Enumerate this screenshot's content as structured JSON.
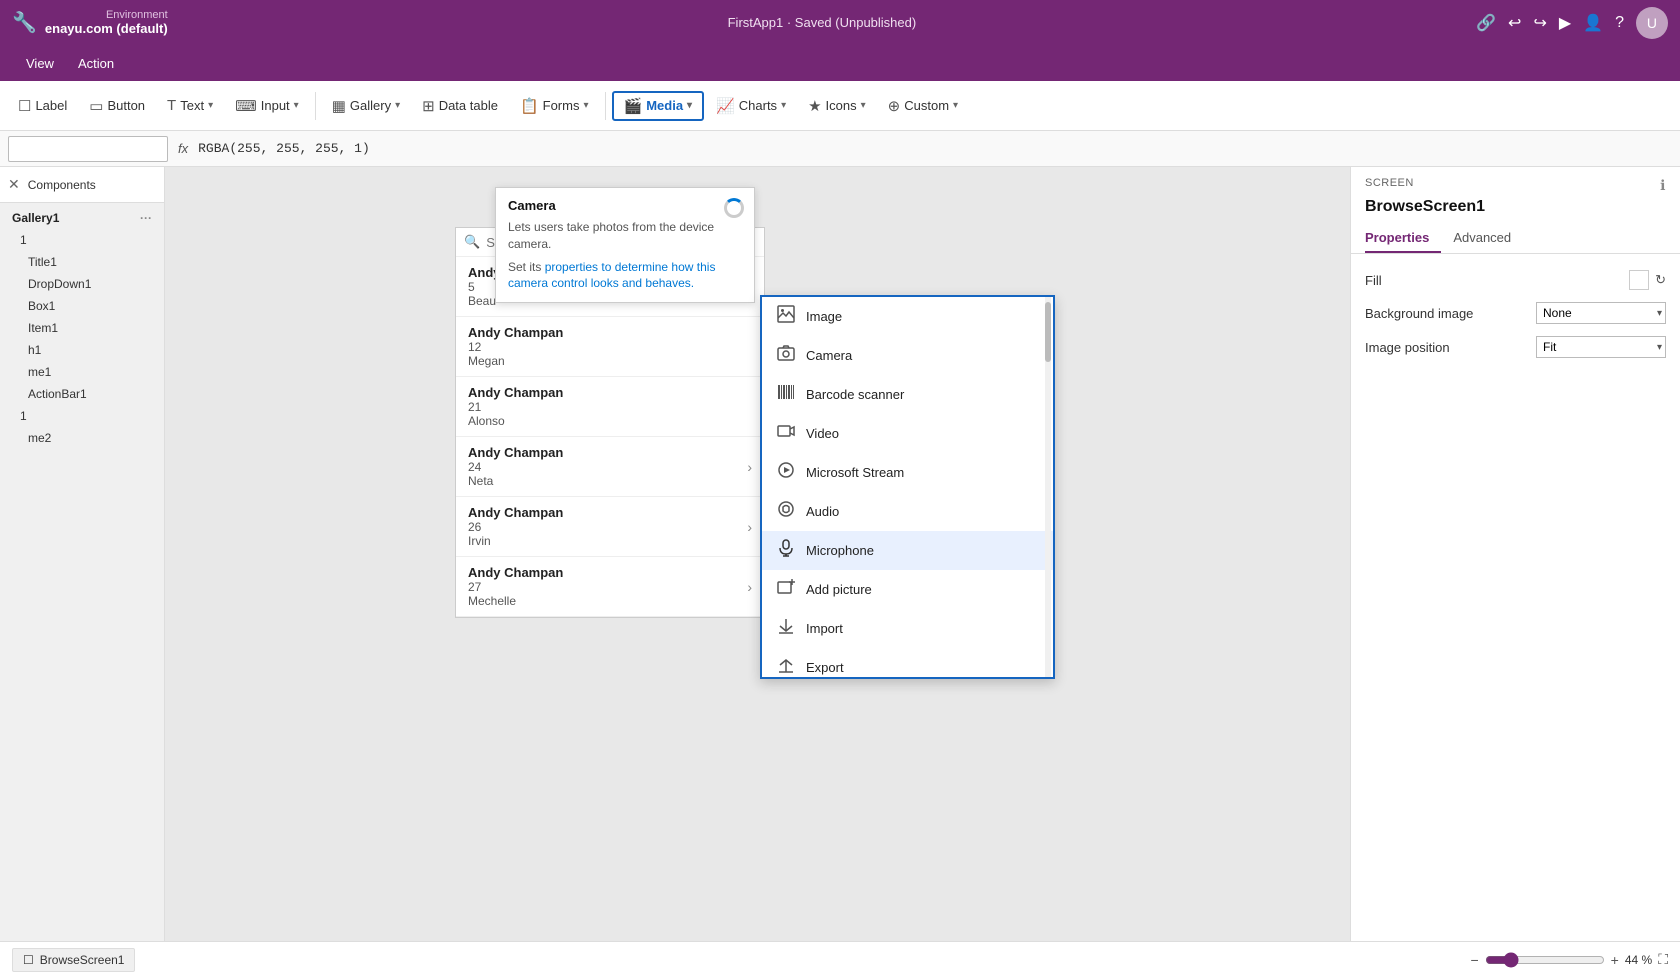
{
  "titleBar": {
    "env_label": "Environment",
    "env_name": "enayu.com (default)",
    "avatar_initials": "U"
  },
  "menuBar": {
    "items": [
      "View",
      "Action"
    ],
    "app_title": "FirstApp1 · Saved (Unpublished)"
  },
  "toolbar": {
    "label_btn": "Label",
    "button_btn": "Button",
    "text_btn": "Text",
    "input_btn": "Input",
    "gallery_btn": "Gallery",
    "datatable_btn": "Data table",
    "forms_btn": "Forms",
    "media_btn": "Media",
    "charts_btn": "Charts",
    "icons_btn": "Icons",
    "custom_btn": "Custom"
  },
  "formulaBar": {
    "selector_value": "",
    "formula_label": "fx",
    "formula_value": "RGBA(255, 255, 255, 1)"
  },
  "leftPanel": {
    "title": "Components",
    "treeItems": [
      {
        "id": "gallery1",
        "label": "Gallery1",
        "indent": 0
      },
      {
        "id": "item1",
        "label": "1",
        "indent": 1
      },
      {
        "id": "title1",
        "label": "Title1",
        "indent": 2
      },
      {
        "id": "dropdown1",
        "label": "DropDown1",
        "indent": 2
      },
      {
        "id": "box1",
        "label": "Box1",
        "indent": 2
      },
      {
        "id": "item1b",
        "label": "Item1",
        "indent": 2
      },
      {
        "id": "h1",
        "label": "h1",
        "indent": 2
      },
      {
        "id": "me1",
        "label": "me1",
        "indent": 2
      },
      {
        "id": "actionbar1",
        "label": "ActionBar1",
        "indent": 2
      },
      {
        "id": "item2",
        "label": "1",
        "indent": 1
      },
      {
        "id": "me2",
        "label": "me2",
        "indent": 2
      }
    ]
  },
  "cameraTooltip": {
    "title": "Camera",
    "description": "Lets users take photos from the device camera.",
    "linkText1": "properties to determine how this",
    "linkText2": "camera control looks and behaves.",
    "prefix": "Set its "
  },
  "searchBar": {
    "placeholder": "Search items"
  },
  "listItems": [
    {
      "name": "Andy Champan",
      "num": "5",
      "sub": "Beau"
    },
    {
      "name": "Andy Champan",
      "num": "12",
      "sub": "Megan"
    },
    {
      "name": "Andy Champan",
      "num": "21",
      "sub": "Alonso"
    },
    {
      "name": "Andy Champan",
      "num": "24",
      "sub": "Neta"
    },
    {
      "name": "Andy Champan",
      "num": "26",
      "sub": "Irvin"
    },
    {
      "name": "Andy Champan",
      "num": "27",
      "sub": "Mechelle"
    }
  ],
  "mediaDropdown": {
    "items": [
      {
        "icon": "🖼",
        "label": "Image"
      },
      {
        "icon": "📷",
        "label": "Camera"
      },
      {
        "icon": "📊",
        "label": "Barcode scanner"
      },
      {
        "icon": "🎬",
        "label": "Video"
      },
      {
        "icon": "▶",
        "label": "Microsoft Stream"
      },
      {
        "icon": "🎧",
        "label": "Audio"
      },
      {
        "icon": "🎤",
        "label": "Microphone"
      },
      {
        "icon": "🖼",
        "label": "Add picture"
      },
      {
        "icon": "↩",
        "label": "Import"
      },
      {
        "icon": "↪",
        "label": "Export"
      }
    ],
    "highlighted": "Microphone"
  },
  "rightPanel": {
    "screen_label": "SCREEN",
    "screen_name": "BrowseScreen1",
    "tabs": [
      "Properties",
      "Advanced"
    ],
    "active_tab": "Properties",
    "properties": {
      "fill_label": "Fill",
      "bg_image_label": "Background image",
      "bg_image_value": "None",
      "img_position_label": "Image position",
      "img_position_value": "Fit"
    }
  },
  "bottomBar": {
    "screen_tab": "BrowseScreen1",
    "zoom_minus": "−",
    "zoom_plus": "+",
    "zoom_value": "44 %"
  }
}
